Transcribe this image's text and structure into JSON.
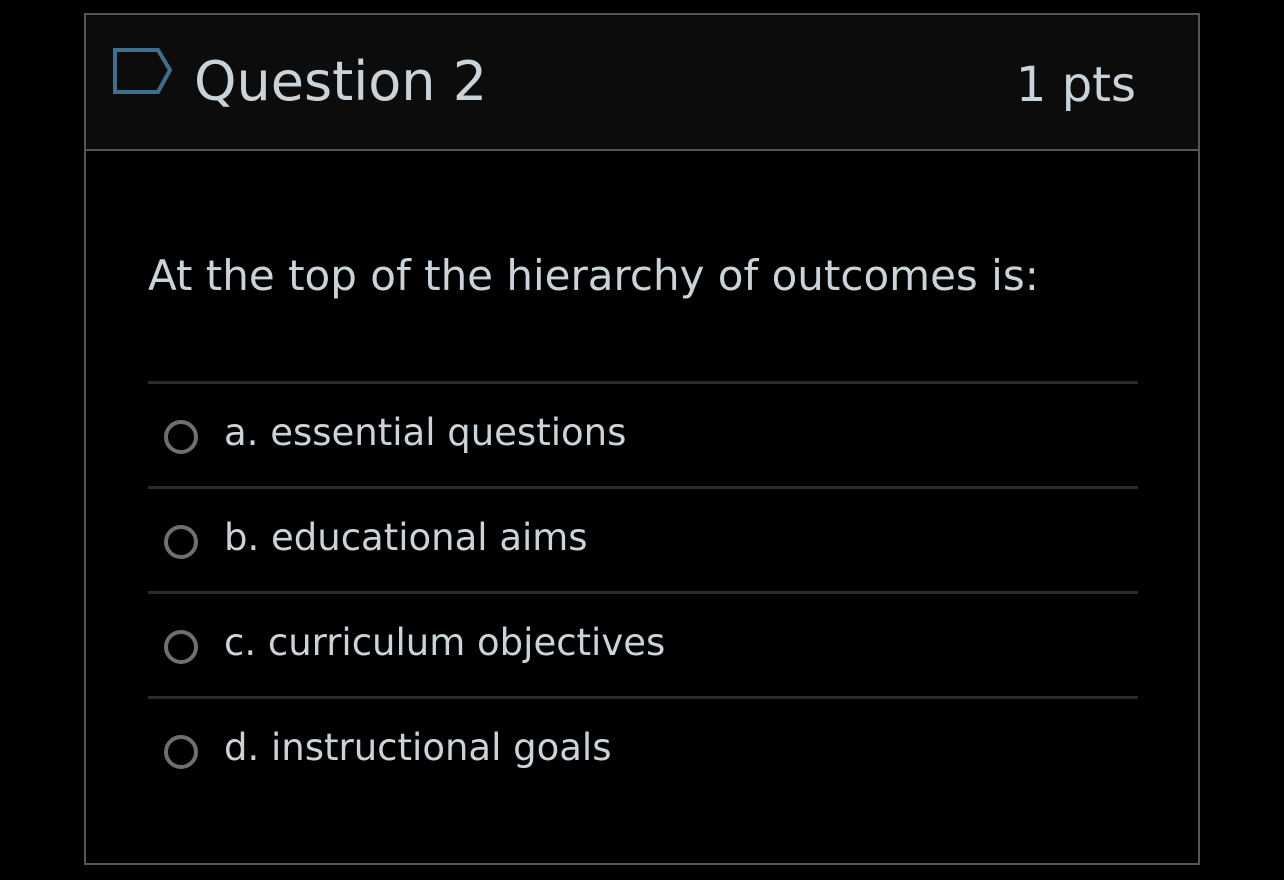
{
  "question": {
    "title": "Question 2",
    "points": "1 pts",
    "flag_icon": "flag-icon",
    "text": "At the top of the hierarchy of outcomes is:",
    "answers": [
      {
        "label": "a. essential questions",
        "selected": false
      },
      {
        "label": "b. educational aims",
        "selected": false
      },
      {
        "label": "c. curriculum objectives",
        "selected": false
      },
      {
        "label": "d. instructional goals",
        "selected": false
      }
    ]
  },
  "colors": {
    "background": "#000000",
    "header_background": "#0c0c0c",
    "text": "#c9d3d9",
    "border": "#555555",
    "divider": "#2a2a2a",
    "radio_border": "#6f6f6f",
    "flag_stroke": "#3d6f8e"
  }
}
